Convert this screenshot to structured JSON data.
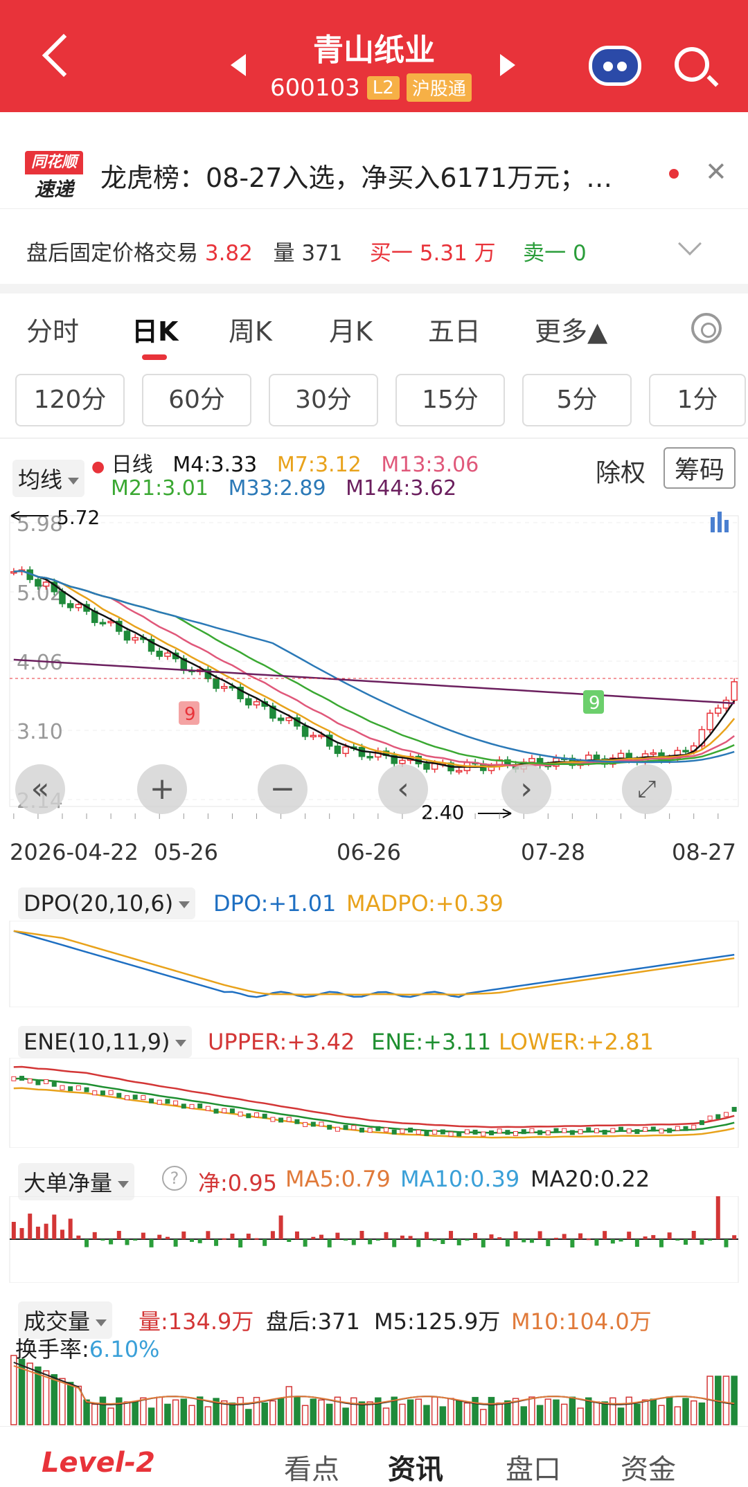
{
  "header": {
    "title": "青山纸业",
    "code": "600103",
    "level_badge": "L2",
    "market_badge": "沪股通"
  },
  "news": {
    "logo_top": "同花顺",
    "logo_bottom": "速递",
    "text": "龙虎榜：08-27入选，净买入6171万元；…"
  },
  "after_hours": {
    "label": "盘后固定价格交易",
    "price": "3.82",
    "vol_label": "量",
    "vol": "371",
    "buy1_label": "买一",
    "buy1": "5.31 万",
    "sell1_label": "卖一",
    "sell1": "0"
  },
  "period_tabs": [
    "分时",
    "日K",
    "周K",
    "月K",
    "五日",
    "更多▲"
  ],
  "minute_pills": [
    "120分",
    "60分",
    "30分",
    "15分",
    "5分",
    "1分"
  ],
  "main_chart": {
    "indicator_dd": "均线",
    "series_label": "日线",
    "ma": [
      {
        "name": "M4",
        "value": "3.33",
        "color": "#111111"
      },
      {
        "name": "M7",
        "value": "3.12",
        "color": "#e8a21b"
      },
      {
        "name": "M13",
        "value": "3.06",
        "color": "#e0587a"
      },
      {
        "name": "M21",
        "value": "3.01",
        "color": "#3aa832"
      },
      {
        "name": "M33",
        "value": "2.89",
        "color": "#2b79b7"
      },
      {
        "name": "M144",
        "value": "3.62",
        "color": "#6b1f5e"
      }
    ],
    "fuquan": "除权",
    "chouma": "筹码",
    "y_ticks": [
      "5.98",
      "5.02",
      "4.06",
      "3.10",
      "2.14"
    ],
    "max_mark": "5.72",
    "min_mark": "2.40",
    "x_ticks": [
      "2026-04-22",
      "05-26",
      "06-26",
      "07-28",
      "08-27"
    ],
    "nine_label": "9"
  },
  "dpo": {
    "dd": "DPO(20,10,6)",
    "dpo": "DPO:+1.01",
    "madpo": "MADPO:+0.39"
  },
  "ene": {
    "dd": "ENE(10,11,9)",
    "upper": "UPPER:+3.42",
    "ene": "ENE:+3.11",
    "lower": "LOWER:+2.81"
  },
  "bigorder": {
    "dd": "大单净量",
    "net": "净:0.95",
    "ma5": "MA5:0.79",
    "ma10": "MA10:0.39",
    "ma20": "MA20:0.22"
  },
  "volume": {
    "dd": "成交量",
    "vol": "量:134.9万",
    "after": "盘后:371",
    "m5": "M5:125.9万",
    "m10": "M10:104.0万",
    "turnover_label": "换手率:",
    "turnover": "6.10%"
  },
  "bottom_tabs": [
    "Level-2",
    "看点",
    "资讯",
    "盘口",
    "资金"
  ],
  "chart_data": {
    "type": "candlestick",
    "x_ticks": [
      "2026-04-22",
      "05-26",
      "06-26",
      "07-28",
      "08-27"
    ],
    "y_ticks": [
      5.98,
      5.02,
      4.06,
      3.1,
      2.14
    ],
    "ylim": [
      2.14,
      5.98
    ],
    "max_price": 5.72,
    "min_price": 2.4,
    "ma_latest": {
      "M4": 3.33,
      "M7": 3.12,
      "M13": 3.06,
      "M21": 3.01,
      "M33": 2.89,
      "M144": 3.62
    }
  }
}
